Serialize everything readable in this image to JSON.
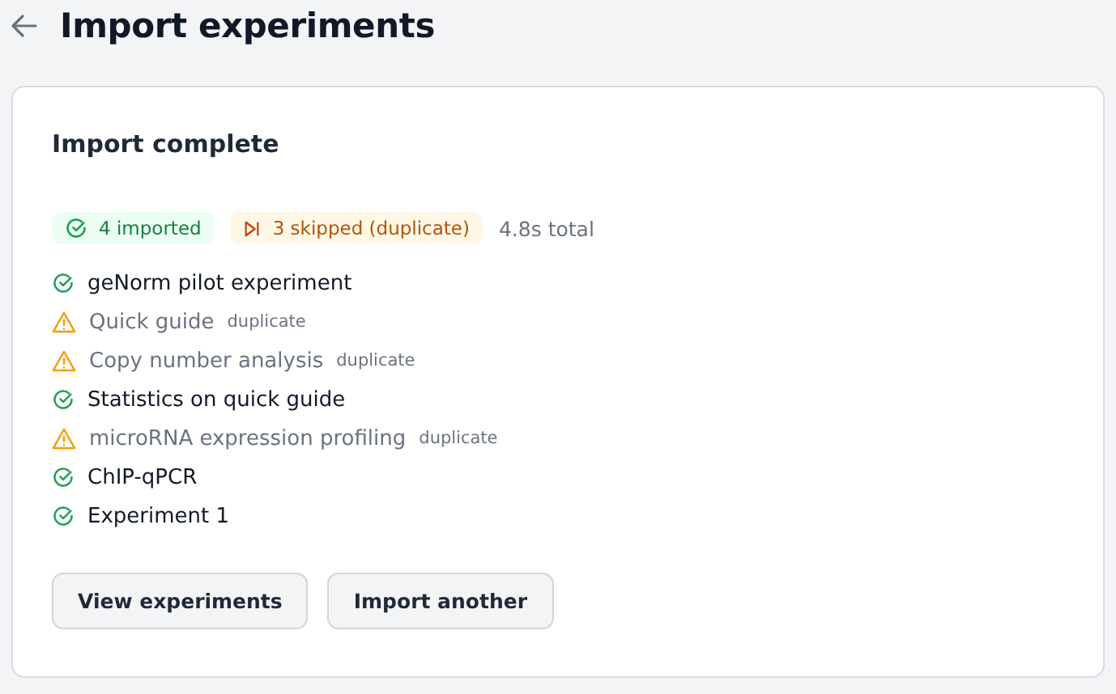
{
  "page": {
    "title": "Import experiments"
  },
  "card": {
    "title": "Import complete",
    "summary": [
      {
        "kind": "imported",
        "label": "4 imported"
      },
      {
        "kind": "skipped",
        "label": "3 skipped (duplicate)"
      }
    ],
    "total": "4.8s total",
    "items": [
      {
        "kind": "imported",
        "name": "geNorm pilot experiment"
      },
      {
        "kind": "skipped",
        "name": "Quick guide",
        "note": "duplicate"
      },
      {
        "kind": "skipped",
        "name": "Copy number analysis",
        "note": "duplicate"
      },
      {
        "kind": "imported",
        "name": "Statistics on quick guide"
      },
      {
        "kind": "skipped",
        "name": "microRNA expression profiling",
        "note": "duplicate"
      },
      {
        "kind": "imported",
        "name": "ChIP-qPCR"
      },
      {
        "kind": "imported",
        "name": "Experiment 1"
      }
    ],
    "buttons": [
      "View experiments",
      "Import another"
    ]
  }
}
